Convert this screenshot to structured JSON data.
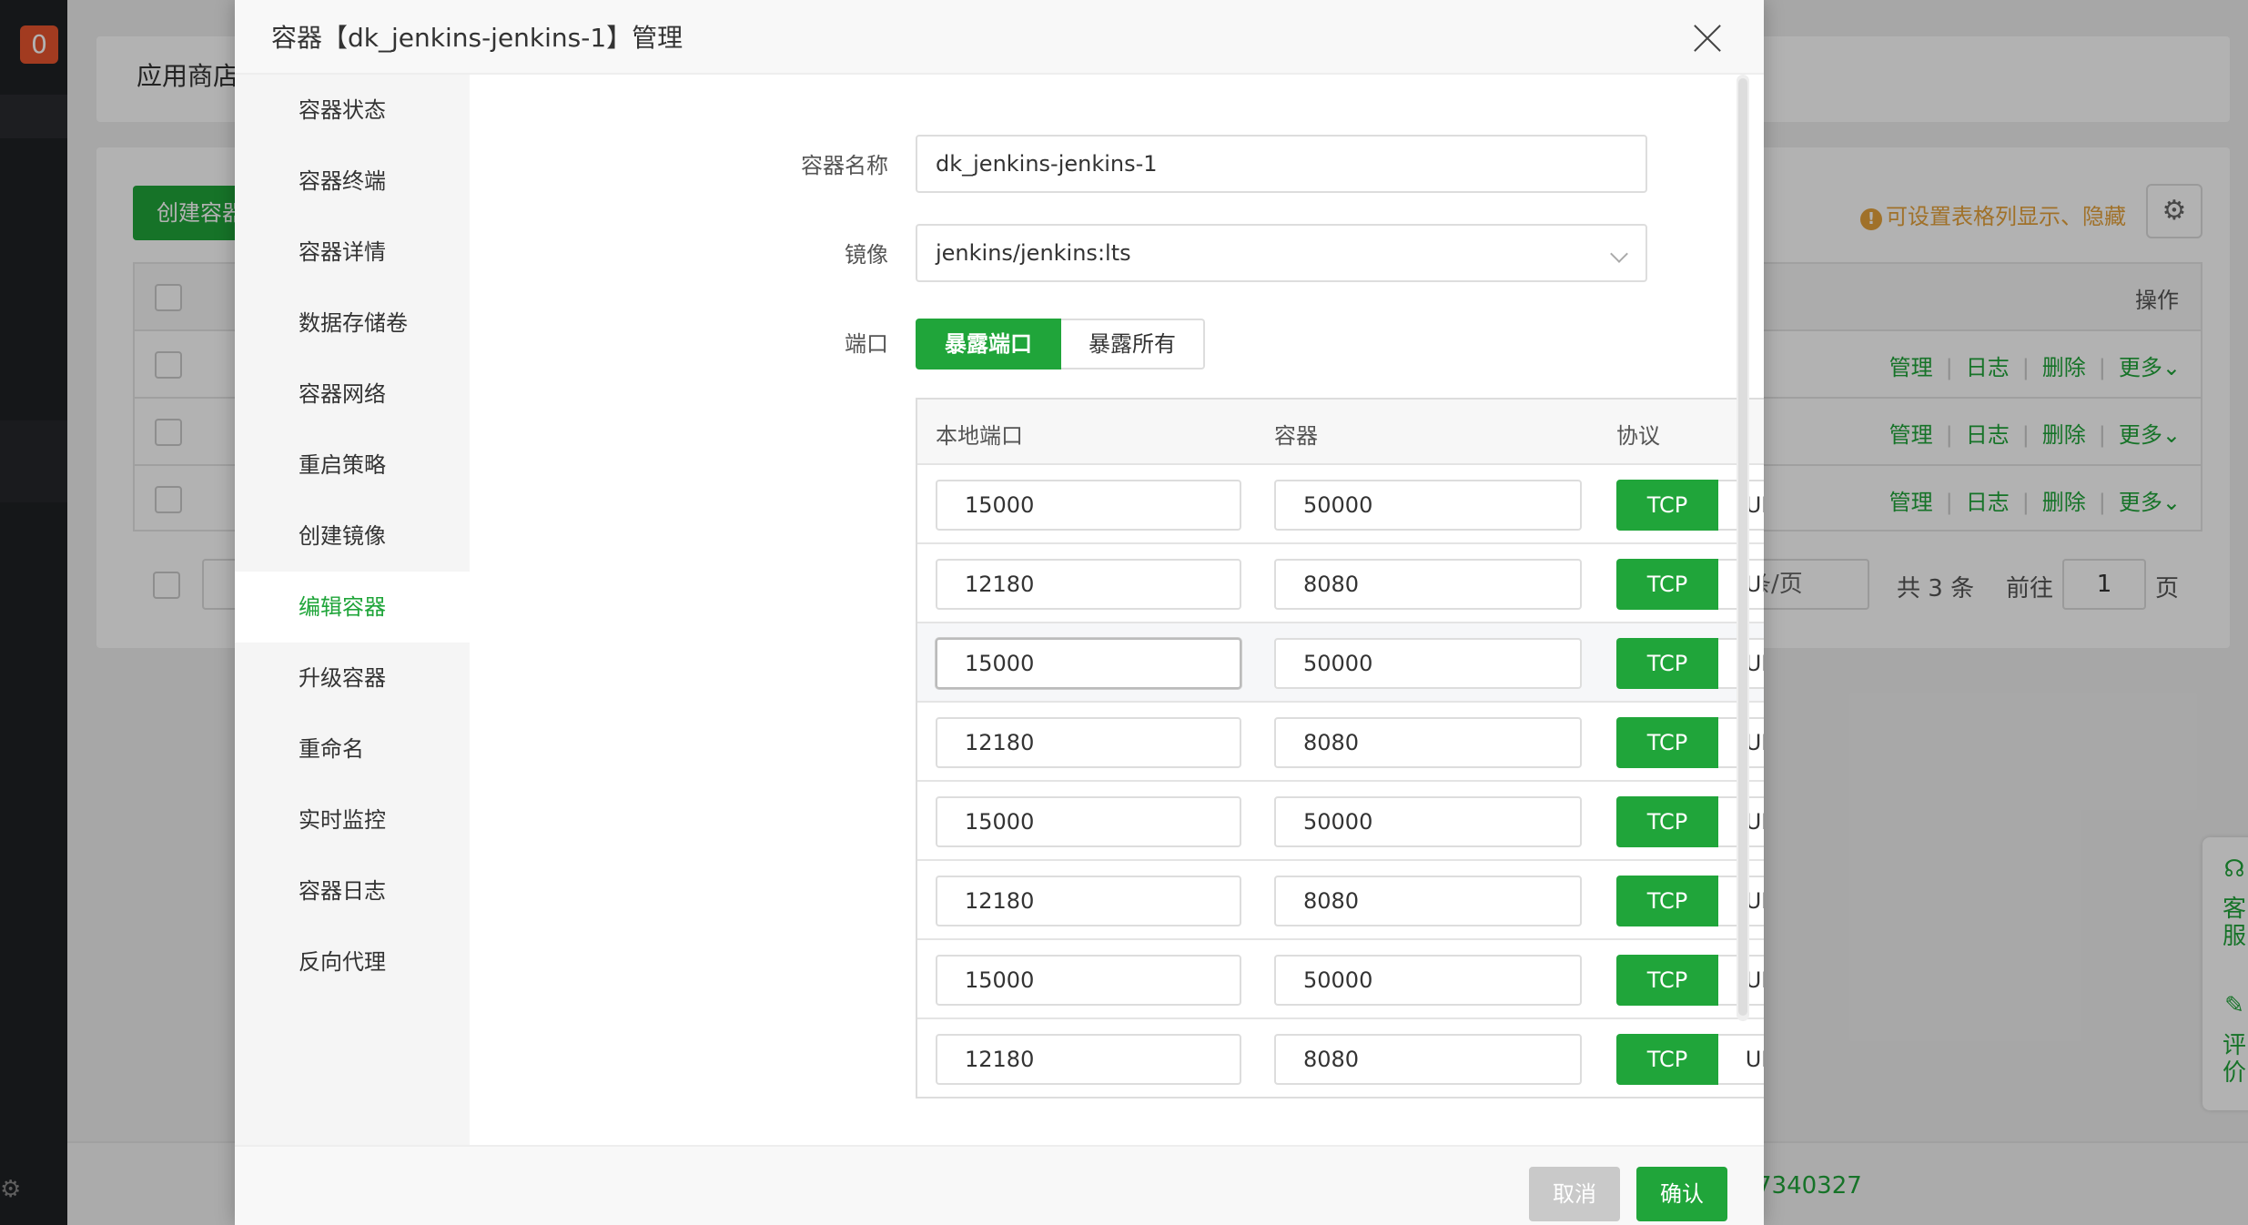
{
  "background": {
    "badge": "0",
    "header_title": "应用商店",
    "create_button": "创建容器",
    "tip": "可设置表格列显示、隐藏",
    "table": {
      "op_header": "操作",
      "ops": {
        "manage": "管理",
        "log": "日志",
        "delete": "删除",
        "more": "更多"
      }
    },
    "pager": {
      "per_page": "条/页",
      "total": "共 3 条",
      "goto": "前往",
      "page": "1",
      "page_unit": "页"
    },
    "footer_text": "7340327",
    "float": {
      "service": "客服",
      "review": "评价"
    }
  },
  "modal": {
    "title": "容器【dk_jenkins-jenkins-1】管理",
    "tabs": [
      "容器状态",
      "容器终端",
      "容器详情",
      "数据存储卷",
      "容器网络",
      "重启策略",
      "创建镜像",
      "编辑容器",
      "升级容器",
      "重命名",
      "实时监控",
      "容器日志",
      "反向代理"
    ],
    "active_tab": "编辑容器",
    "form": {
      "name_label": "容器名称",
      "name_value": "dk_jenkins-jenkins-1",
      "image_label": "镜像",
      "image_value": "jenkins/jenkins:lts",
      "port_label": "端口",
      "expose_port": "暴露端口",
      "expose_all": "暴露所有"
    },
    "port_table": {
      "headers": {
        "local": "本地端口",
        "container": "容器",
        "protocol": "协议"
      },
      "rows": [
        {
          "local": "15000",
          "container": "50000",
          "tcp": "TCP",
          "udp": "UDP"
        },
        {
          "local": "12180",
          "container": "8080",
          "tcp": "TCP",
          "udp": "UDP"
        },
        {
          "local": "15000",
          "container": "50000",
          "tcp": "TCP",
          "udp": "UDP"
        },
        {
          "local": "12180",
          "container": "8080",
          "tcp": "TCP",
          "udp": "UDP"
        },
        {
          "local": "15000",
          "container": "50000",
          "tcp": "TCP",
          "udp": "UDP"
        },
        {
          "local": "12180",
          "container": "8080",
          "tcp": "TCP",
          "udp": "UDP"
        },
        {
          "local": "15000",
          "container": "50000",
          "tcp": "TCP",
          "udp": "UDP"
        },
        {
          "local": "12180",
          "container": "8080",
          "tcp": "TCP",
          "udp": "UDP"
        }
      ]
    },
    "footer": {
      "cancel": "取消",
      "confirm": "确认"
    }
  },
  "colors": {
    "accent": "#20a53a",
    "warning": "#e6a23c",
    "badge": "#e8552f"
  }
}
